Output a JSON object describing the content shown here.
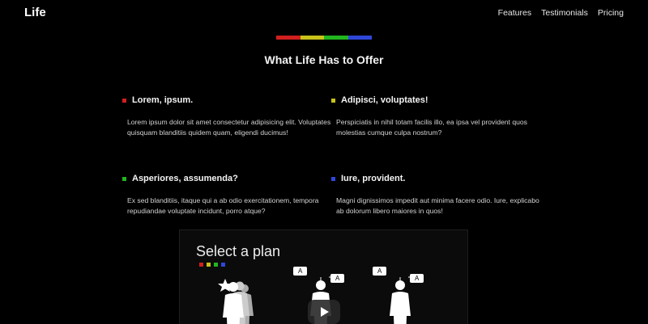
{
  "nav": {
    "brand": "Life",
    "links": [
      "Features",
      "Testimonials",
      "Pricing"
    ]
  },
  "colors": {
    "red": "#d11f1f",
    "yellow": "#c8c21a",
    "green": "#22b51f",
    "blue": "#2f47d8"
  },
  "section": {
    "title": "What Life Has to Offer"
  },
  "features": [
    {
      "title": "Lorem, ipsum.",
      "body": "Lorem ipsum dolor sit amet consectetur adipisicing elit. Voluptates quisquam blanditiis quidem quam, eligendi ducimus!",
      "color": "red"
    },
    {
      "title": "Adipisci, voluptates!",
      "body": "Perspiciatis in nihil totam facilis illo, ea ipsa vel provident quos molestias cumque culpa nostrum?",
      "color": "yellow"
    },
    {
      "title": "Asperiores, assumenda?",
      "body": "Ex sed blanditiis, itaque qui a ab odio exercitationem, tempora repudiandae voluptate incidunt, porro atque?",
      "color": "green"
    },
    {
      "title": "Iure, provident.",
      "body": "Magni dignissimos impedit aut minima facere odio. Iure, explicabo ab dolorum libero maiores in quos!",
      "color": "blue"
    }
  ],
  "video": {
    "title": "Select a plan",
    "badge_letter": "A",
    "icons": [
      "star-icon",
      "play-icon"
    ]
  }
}
